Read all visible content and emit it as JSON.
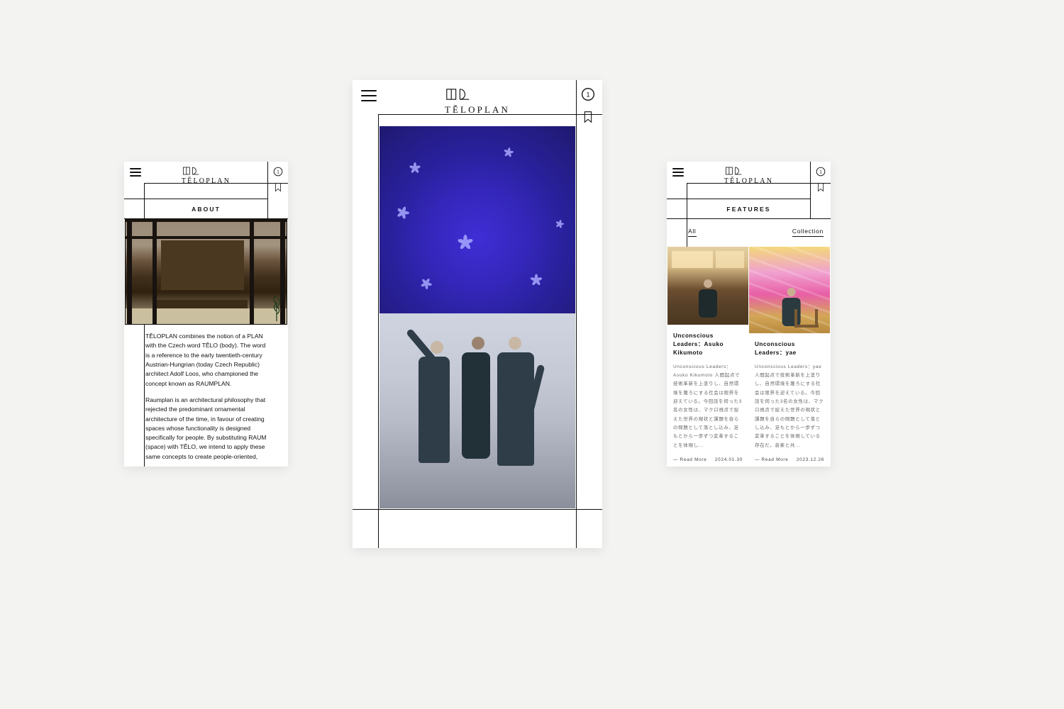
{
  "brand": {
    "name": "TĚLOPLAN"
  },
  "cart_count": "1",
  "about": {
    "section": "ABOUT",
    "p1": "TĚLOPLAN combines the notion of a PLAN with the Czech word TĚLO (body). The word is a reference to the early twentieth-century Austrian-Hungrian (today Czech Republic) architect Adolf Loos, who championed the concept known as RAUMPLAN.",
    "p2": "Raumplan is an architectural philosophy that rejected the predominant ornamental architecture of the time, in favour of creating spaces whose functionality is designed specifically for people. By substituting RAUM (space) with TĚLO, we intend to apply these same concepts to create people-oriented,"
  },
  "features": {
    "section": "FEATURES",
    "filters": {
      "all": "All",
      "collection": "Collection"
    },
    "cards": [
      {
        "title": "Unconscious Leaders：Asuko Kikumoto",
        "desc": "Unconscious Leaders：Asuko Kikumoto 人間起点で技術革新を上塗りし、自然環境を蔑ろにする社会は限界を迎えている。今回話を伺った3名の女性は、マクロ視点で捉えた世界の現状と課題を自らの問題として落とし込み、足もとから一歩ずつ変革することを体現し...",
        "readmore": "— Read More",
        "date": "2024.01.30"
      },
      {
        "title": "Unconscious Leaders：yae",
        "desc": "Unconscious Leaders：yae 人間起点で技術革新を上塗りし、自然環境を蔑ろにする社会は限界を迎えている。今回話を伺った3名の女性は、マクロ視点で捉えた世界の現状と課題を自らの問題として落とし込み、足もとから一歩ずつ変革することを体現している存在だ。音楽と共...",
        "readmore": "— Read More",
        "date": "2023.12.26"
      }
    ]
  }
}
